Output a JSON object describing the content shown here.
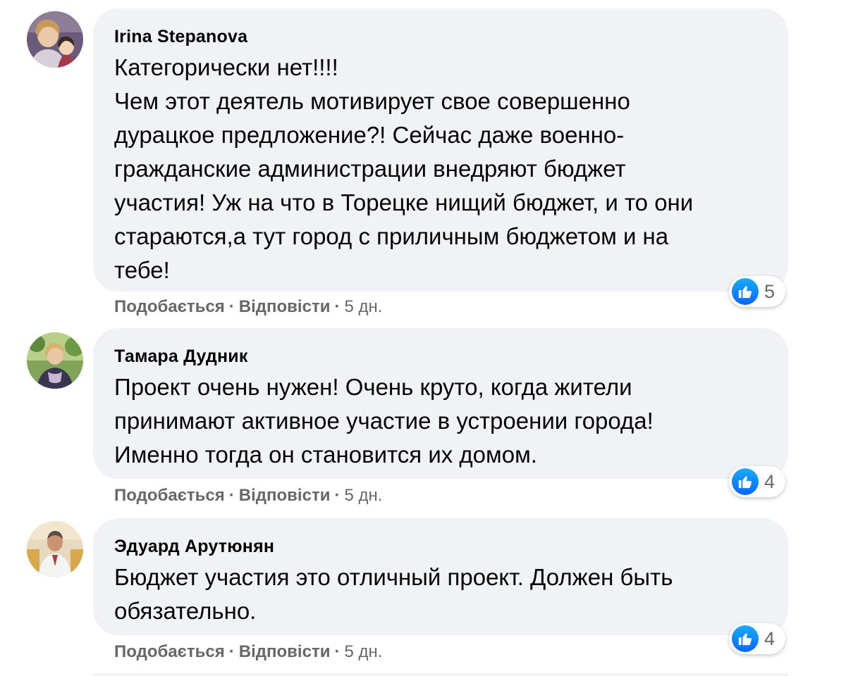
{
  "comments": [
    {
      "author": "Irina Stepanova",
      "text": "Категорически нет!!!!\nЧем этот деятель мотивирует свое совершенно\nдурацкое предложение?! Сейчас даже военно-\nгражданские администрации внедряют бюджет\nучастия! Уж на что в Торецке нищий бюджет, и то они\nстараются,а тут город с приличным бюджетом и на\nтебе!",
      "reaction_count": "5",
      "like_label": "Подобається",
      "reply_label": "Відповісти",
      "time": "5 дн."
    },
    {
      "author": "Тамара Дудник",
      "text": "Проект очень нужен! Очень круто, когда жители\nпринимают активное участие в устроении города!\nИменно тогда он становится их домом.",
      "reaction_count": "4",
      "like_label": "Подобається",
      "reply_label": "Відповісти",
      "time": "5 дн."
    },
    {
      "author": "Эдуард Арутюнян",
      "text": "Бюджет участия это отличный проект. Должен быть\nобязательно.",
      "reaction_count": "4",
      "like_label": "Подобається",
      "reply_label": "Відповісти",
      "time": "5 дн."
    }
  ],
  "separator": "·",
  "icons": {
    "reaction": "thumbs-up-icon"
  },
  "colors": {
    "bubble_bg": "#f0f2f5",
    "like_blue": "#0866ff",
    "meta_gray": "#65676b",
    "text": "#050505"
  }
}
